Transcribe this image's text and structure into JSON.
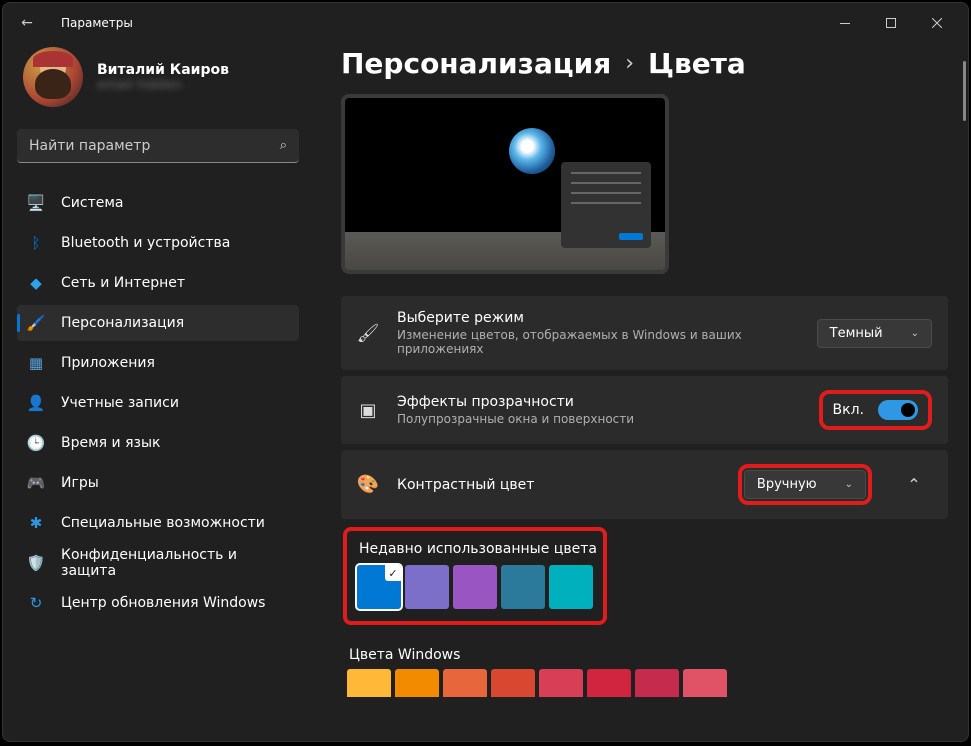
{
  "window_title": "Параметры",
  "user": {
    "name": "Виталий Каиров",
    "email": "email hidden"
  },
  "search": {
    "placeholder": "Найти параметр"
  },
  "nav": [
    {
      "label": "Система",
      "icon": "🖥️",
      "color": "#0078d4"
    },
    {
      "label": "Bluetooth и устройства",
      "icon": "ᛒ",
      "color": "#0078d4"
    },
    {
      "label": "Сеть и Интернет",
      "icon": "◆",
      "color": "#2ea2e8"
    },
    {
      "label": "Персонализация",
      "icon": "🖌️",
      "color": "#d68b3a"
    },
    {
      "label": "Приложения",
      "icon": "▦",
      "color": "#5aa0d8"
    },
    {
      "label": "Учетные записи",
      "icon": "👤",
      "color": "#bbb"
    },
    {
      "label": "Время и язык",
      "icon": "🕒",
      "color": "#bbb"
    },
    {
      "label": "Игры",
      "icon": "🎮",
      "color": "#bbb"
    },
    {
      "label": "Специальные возможности",
      "icon": "✱",
      "color": "#2e98e5"
    },
    {
      "label": "Конфиденциальность и защита",
      "icon": "🛡️",
      "color": "#8a8a8a"
    },
    {
      "label": "Центр обновления Windows",
      "icon": "↻",
      "color": "#2e98e5"
    }
  ],
  "active_nav_index": 3,
  "breadcrumb": {
    "parent": "Персонализация",
    "current": "Цвета"
  },
  "settings": {
    "mode": {
      "title": "Выберите режим",
      "desc": "Изменение цветов, отображаемых в Windows и ваших приложениях",
      "value": "Темный"
    },
    "transparency": {
      "title": "Эффекты прозрачности",
      "desc": "Полупрозрачные окна и поверхности",
      "state_label": "Вкл."
    },
    "accent": {
      "title": "Контрастный цвет",
      "value": "Вручную"
    }
  },
  "recent_colors": {
    "label": "Недавно использованные цвета",
    "colors": [
      "#0078d4",
      "#7b6fc9",
      "#9955c2",
      "#2b7a9b",
      "#00b0bd"
    ],
    "selected_index": 0
  },
  "windows_colors": {
    "label": "Цвета Windows",
    "colors": [
      "#ffb838",
      "#f38b00",
      "#e8663c",
      "#d94730",
      "#d83e55",
      "#d1243e",
      "#c52b4c",
      "#e05265"
    ]
  }
}
